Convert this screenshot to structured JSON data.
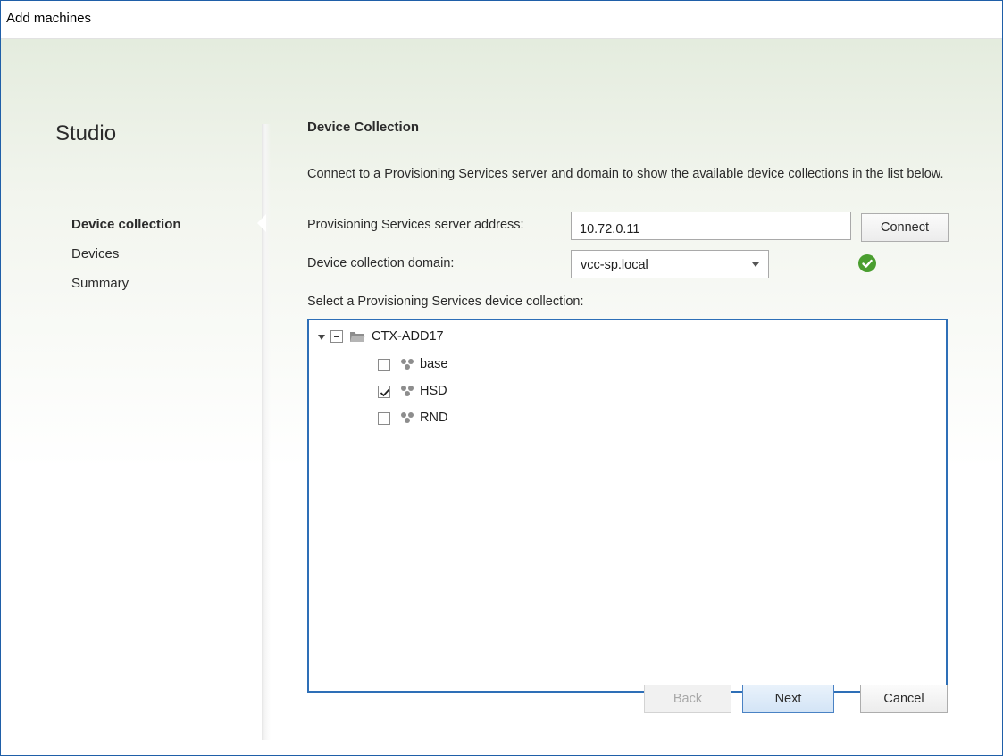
{
  "window": {
    "title": "Add machines"
  },
  "sidebar": {
    "brand": "Studio",
    "items": [
      {
        "label": "Device collection",
        "active": true
      },
      {
        "label": "Devices",
        "active": false
      },
      {
        "label": "Summary",
        "active": false
      }
    ]
  },
  "main": {
    "heading": "Device Collection",
    "description": "Connect to a Provisioning Services server and domain to show the available device collections in the list below.",
    "server_label": "Provisioning Services server address:",
    "server_value": "10.72.0.11",
    "connect_label": "Connect",
    "domain_label": "Device collection domain:",
    "domain_value": "vcc-sp.local",
    "list_label": "Select a Provisioning Services device collection:",
    "tree": {
      "root": {
        "label": "CTX-ADD17",
        "expanded": true,
        "check_state": "partial"
      },
      "children": [
        {
          "label": "base",
          "checked": false
        },
        {
          "label": "HSD",
          "checked": true
        },
        {
          "label": "RND",
          "checked": false
        }
      ]
    }
  },
  "footer": {
    "back_label": "Back",
    "next_label": "Next",
    "cancel_label": "Cancel"
  },
  "colors": {
    "accent_blue": "#2e6fb7",
    "success_green": "#4a9e2f",
    "primary_button_border": "#4a82c4"
  },
  "icons": [
    "expander-icon",
    "folder-icon",
    "device-group-icon",
    "checkmark-icon",
    "dropdown-chevron-icon"
  ]
}
